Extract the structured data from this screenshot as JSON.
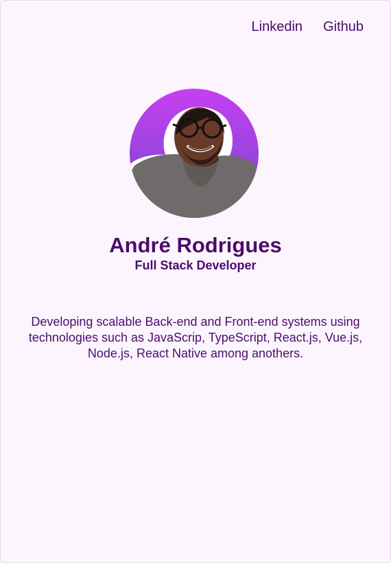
{
  "nav": {
    "links": [
      {
        "label": "Linkedin"
      },
      {
        "label": "Github"
      }
    ]
  },
  "profile": {
    "name": "André Rodrigues",
    "role": "Full Stack Developer",
    "description": "Developing scalable Back-end and Front-end systems using technologies such as JavaScrip, TypeScript, React.js, Vue.js, Node.js, React Native among anothers."
  },
  "colors": {
    "text": "#4d0b6d",
    "background": "#fcf5fd",
    "avatar_gradient_top": "#c640ef",
    "avatar_gradient_bottom": "#6b3fb8"
  },
  "icons": {
    "avatar": "profile-photo"
  }
}
